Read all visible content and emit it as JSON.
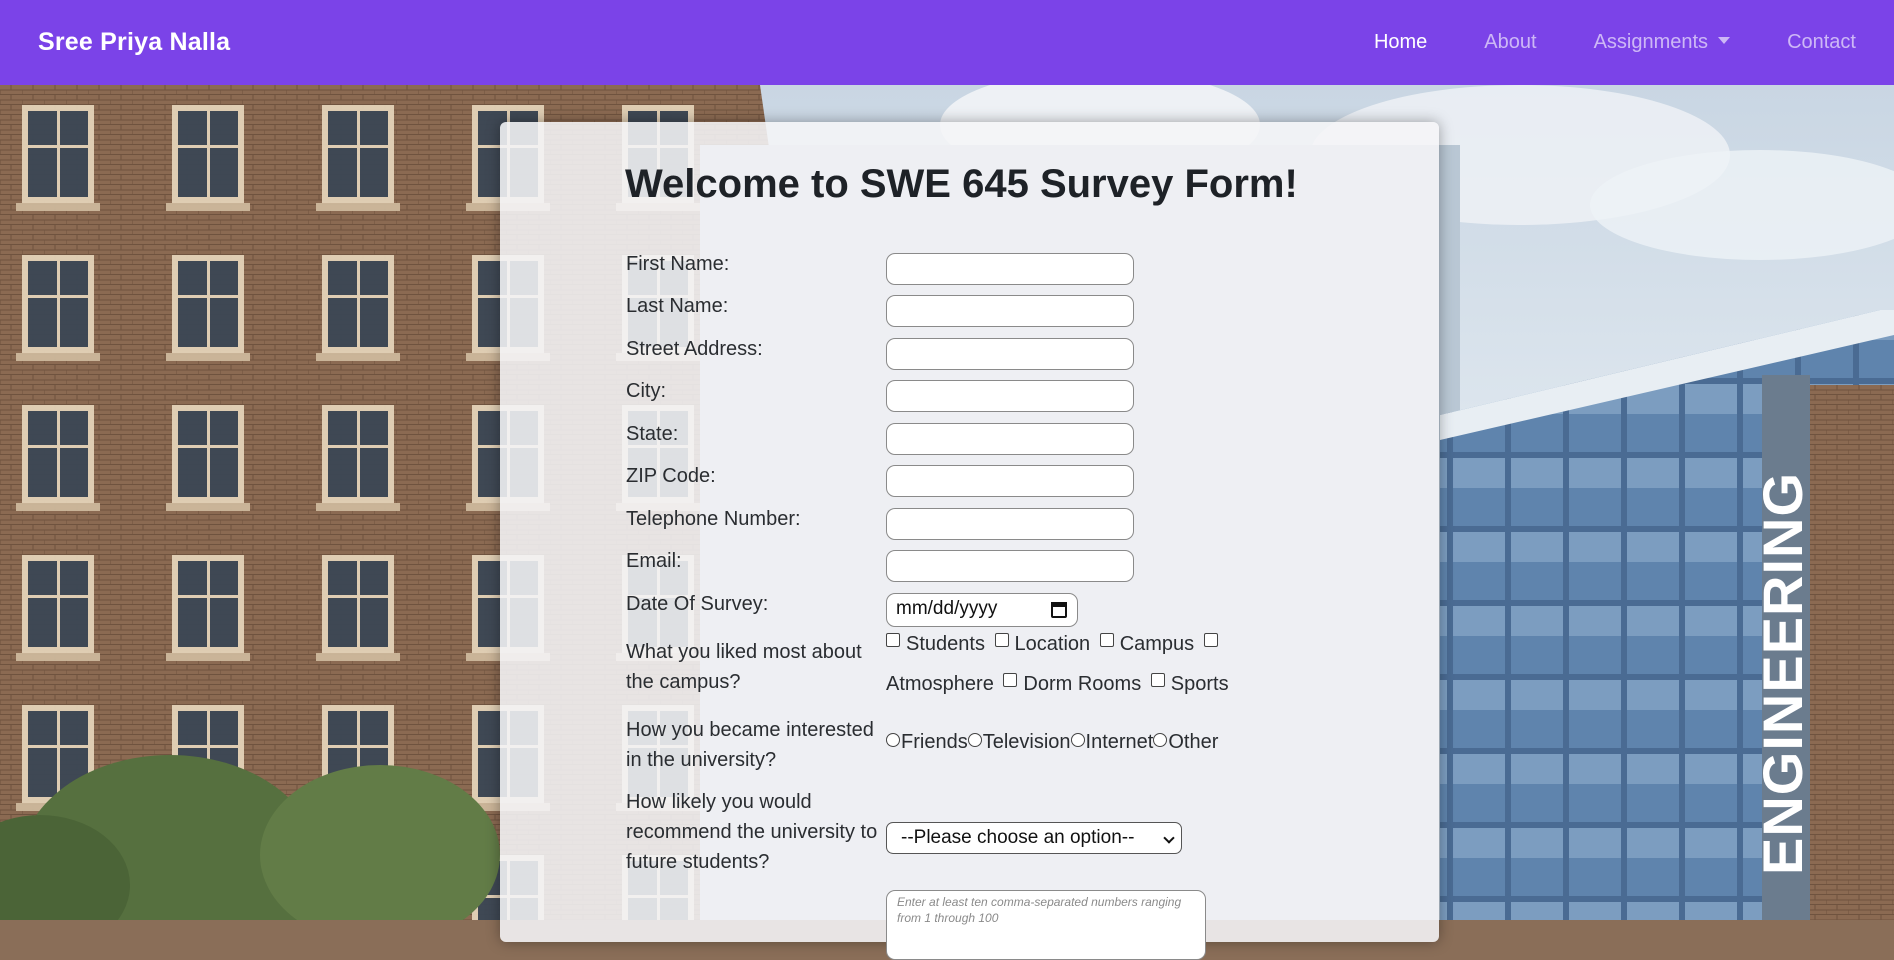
{
  "navbar": {
    "brand": "Sree Priya Nalla",
    "links": [
      {
        "label": "Home",
        "active": true
      },
      {
        "label": "About"
      },
      {
        "label": "Assignments"
      },
      {
        "label": "Contact"
      }
    ]
  },
  "background": {
    "sign_text": "ENGINEERING"
  },
  "form": {
    "title": "Welcome to SWE 645 Survey Form!",
    "fields": {
      "first_name": "First Name:",
      "last_name": "Last Name:",
      "street": "Street Address:",
      "city": "City:",
      "state": "State:",
      "zip": "ZIP Code:",
      "phone": "Telephone Number:",
      "email": "Email:",
      "date": "Date Of Survey:"
    },
    "date_placeholder": "mm/dd/yyyy",
    "liked": {
      "label_line1": "What you liked most about",
      "label_line2": "the campus?",
      "options": [
        "Students",
        "Location",
        "Campus",
        "Atmosphere",
        "Dorm Rooms",
        "Sports"
      ]
    },
    "interest": {
      "label_line1": "How you became interested",
      "label_line2": "in the university?",
      "options": [
        "Friends",
        "Television",
        "Internet",
        "Other"
      ]
    },
    "recommend": {
      "label_line1": "How likely you would",
      "label_line2": "recommend the university to",
      "label_line3": "future students?",
      "selected": "--Please choose an option--"
    },
    "numbers_placeholder": "Enter at least ten comma-separated numbers ranging from 1 through 100"
  },
  "colors": {
    "navbar": "#7b43e8",
    "brand_text": "#ffffff"
  }
}
